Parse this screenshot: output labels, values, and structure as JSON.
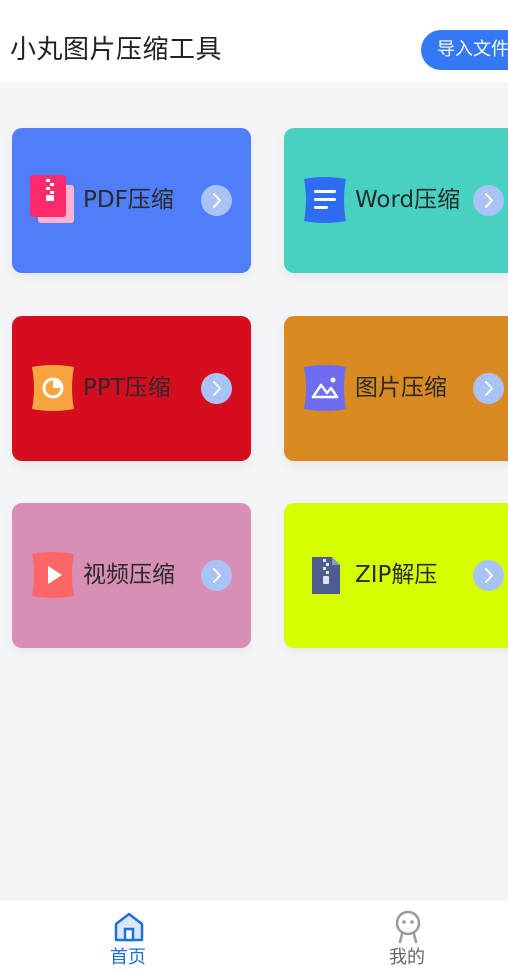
{
  "header": {
    "title": "小丸图片压缩工具",
    "import_label": "导入文件"
  },
  "cards": [
    {
      "label": "PDF压缩",
      "color": "#4f7ef8",
      "icon": "zip-file-icon"
    },
    {
      "label": "Word压缩",
      "color": "#46d1c1",
      "icon": "document-icon"
    },
    {
      "label": "PPT压缩",
      "color": "#d50d1f",
      "icon": "pie-chart-icon"
    },
    {
      "label": "图片压缩",
      "color": "#d98a21",
      "icon": "image-icon"
    },
    {
      "label": "视频压缩",
      "color": "#d88fb6",
      "icon": "play-icon"
    },
    {
      "label": "ZIP解压",
      "color": "#d6fe00",
      "icon": "zip-archive-icon"
    }
  ],
  "tabs": [
    {
      "label": "首页",
      "icon": "home-icon",
      "color": "#1e6fe0"
    },
    {
      "label": "我的",
      "icon": "profile-icon",
      "color": "#666666"
    }
  ]
}
